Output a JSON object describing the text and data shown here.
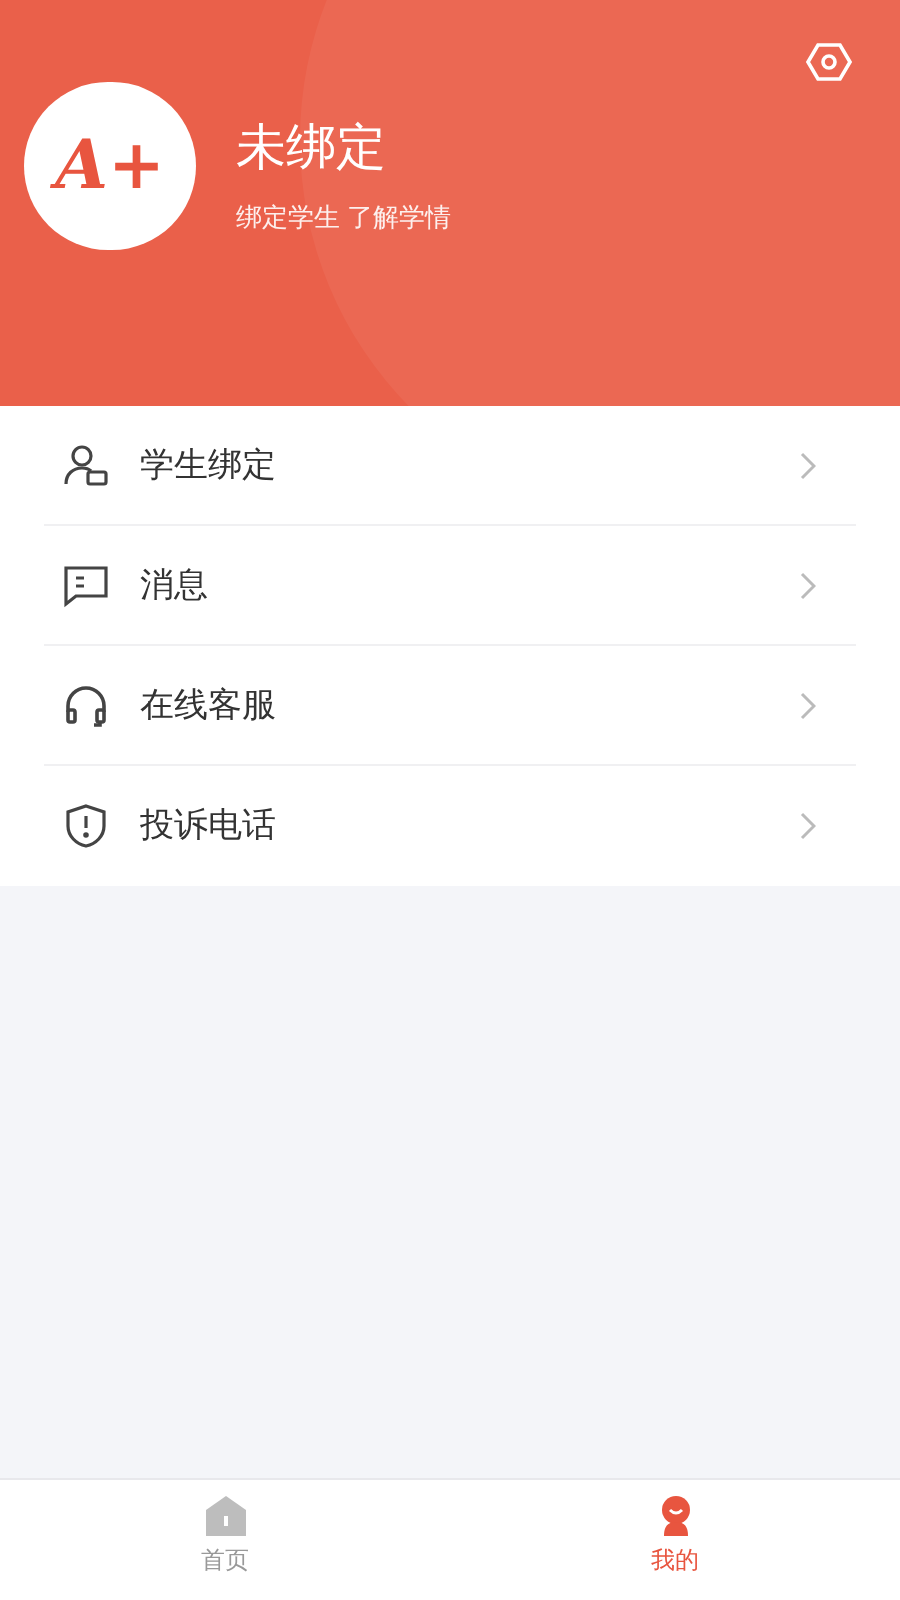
{
  "profile": {
    "avatar_text": "A+",
    "name": "未绑定",
    "subtitle": "绑定学生 了解学情"
  },
  "menu": [
    {
      "kind": "student",
      "label": "学生绑定"
    },
    {
      "kind": "message",
      "label": "消息"
    },
    {
      "kind": "service",
      "label": "在线客服"
    },
    {
      "kind": "complaint",
      "label": "投诉电话"
    }
  ],
  "tabs": [
    {
      "kind": "home",
      "label": "首页",
      "selected": false
    },
    {
      "kind": "mine",
      "label": "我的",
      "selected": true
    }
  ]
}
